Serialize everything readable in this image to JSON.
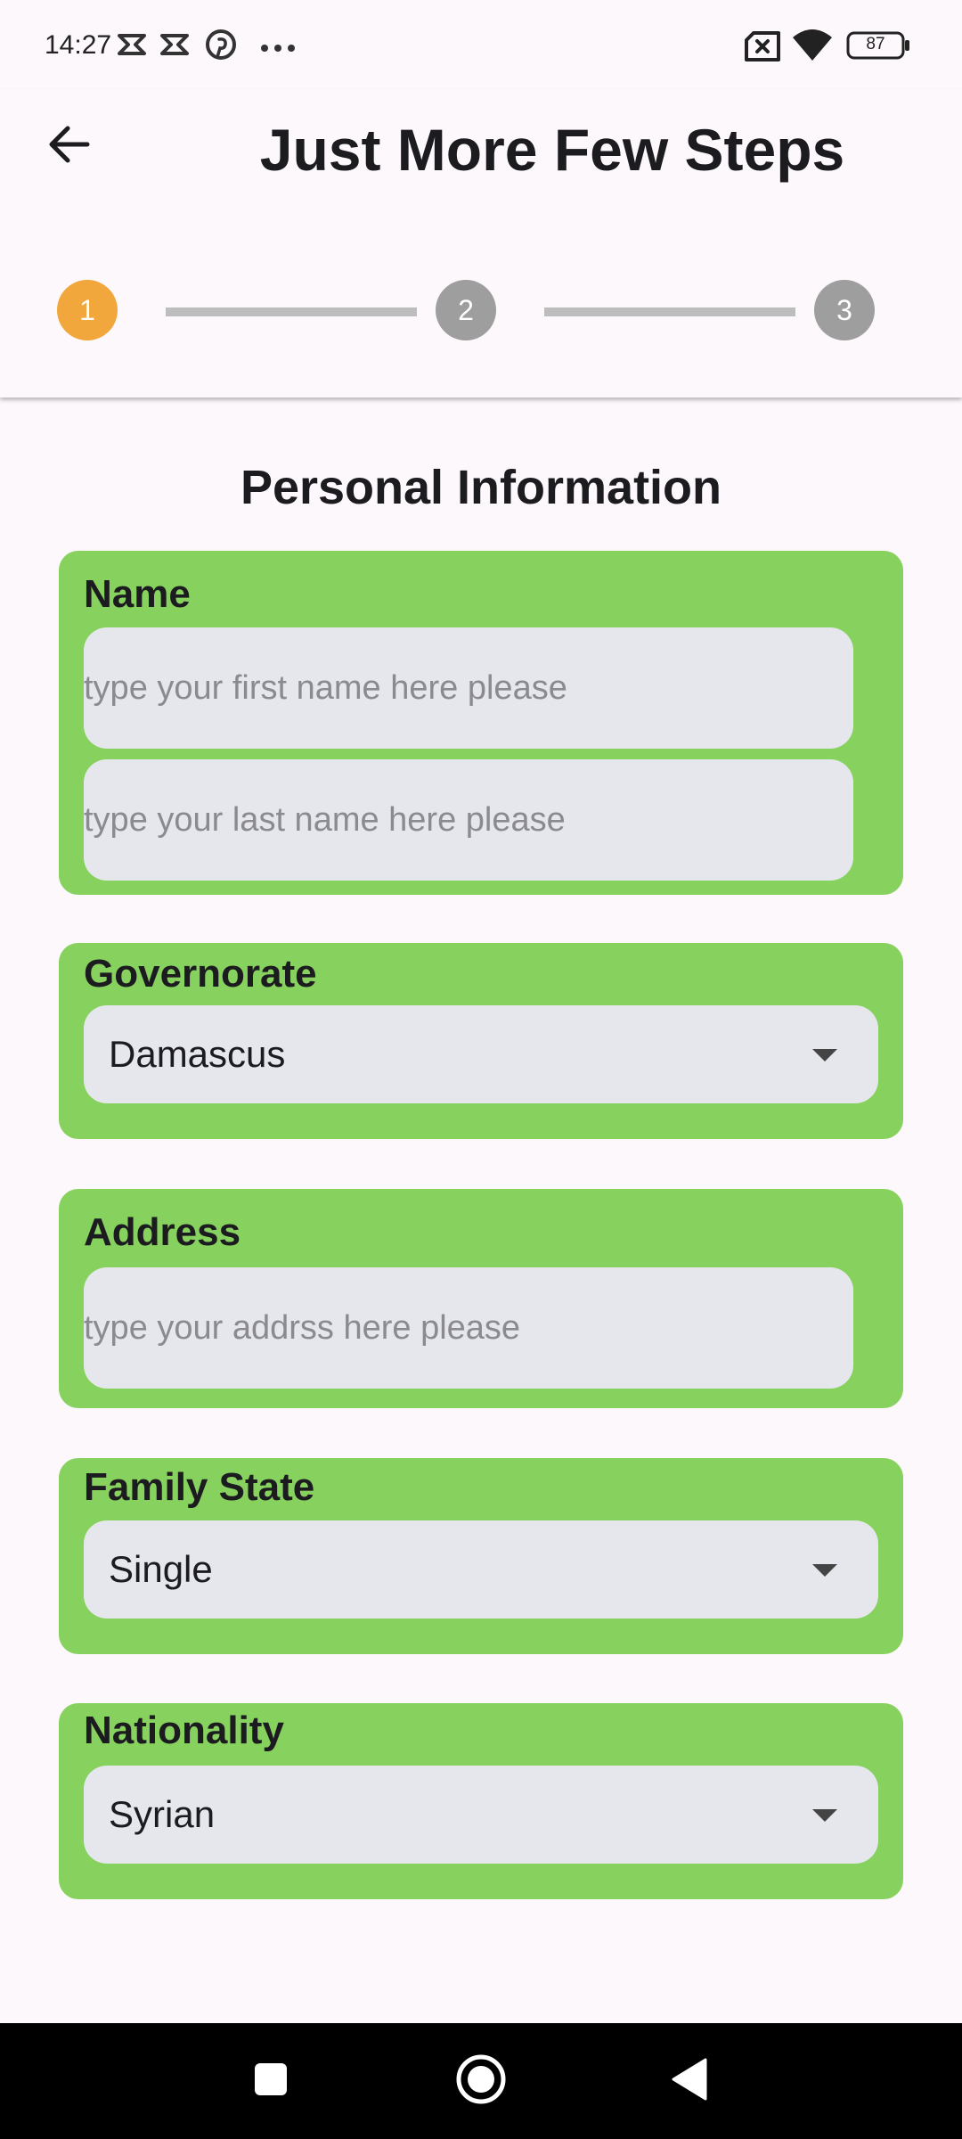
{
  "status_bar": {
    "time": "14:27",
    "battery_level": "87",
    "icons": [
      "capcut-icon",
      "capcut-icon",
      "pinterest-icon",
      "more-dots-icon",
      "sim-disabled-icon",
      "wifi-icon",
      "battery-icon"
    ]
  },
  "header": {
    "title": "Just More Few Steps",
    "back_icon": "arrow-left-icon"
  },
  "stepper": {
    "steps": [
      {
        "label": "1",
        "state": "active",
        "color": "#f2a73d"
      },
      {
        "label": "2",
        "state": "inactive",
        "color": "#9e9e9e"
      },
      {
        "label": "3",
        "state": "inactive",
        "color": "#9e9e9e"
      }
    ],
    "connector_color": "#bdbdbd"
  },
  "form": {
    "section_title": "Personal Information",
    "card_color": "#87d15e",
    "field_bg_color": "#e5e7ed",
    "name": {
      "label": "Name",
      "first_name_placeholder": "type your first name here please",
      "last_name_placeholder": "type your last name here please"
    },
    "governorate": {
      "label": "Governorate",
      "selected": "Damascus"
    },
    "address": {
      "label": "Address",
      "placeholder": "type your addrss here please"
    },
    "family_state": {
      "label": "Family State",
      "selected": "Single"
    },
    "nationality": {
      "label": "Nationality",
      "selected": "Syrian"
    }
  },
  "nav_bar": {
    "buttons": [
      "recents-square-icon",
      "home-circle-icon",
      "back-triangle-icon"
    ]
  }
}
